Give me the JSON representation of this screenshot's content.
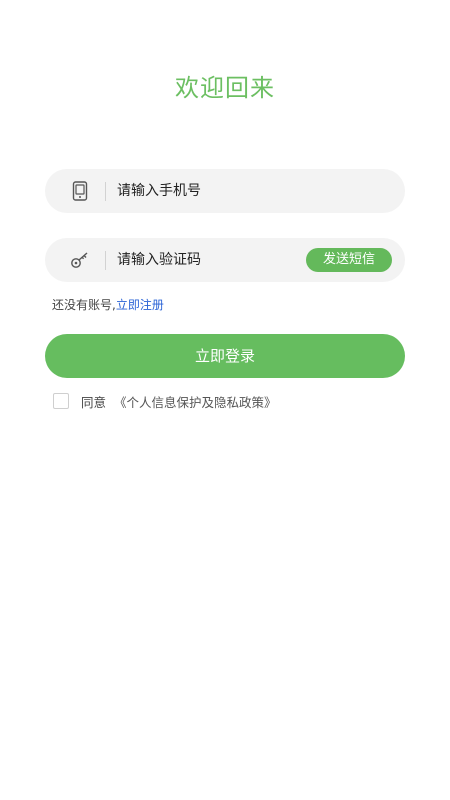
{
  "title": "欢迎回来",
  "phone": {
    "icon": "phone-icon",
    "placeholder": "请输入手机号"
  },
  "code": {
    "icon": "key-icon",
    "placeholder": "请输入验证码",
    "send_label": "发送短信"
  },
  "register": {
    "prompt": "还没有账号,",
    "link": "立即注册"
  },
  "login_label": "立即登录",
  "agreement": {
    "checked": false,
    "label": "同意",
    "policy": "《个人信息保护及隐私政策》"
  },
  "colors": {
    "accent": "#66bd5f",
    "link": "#2a63d6",
    "field_bg": "#f3f3f3"
  }
}
